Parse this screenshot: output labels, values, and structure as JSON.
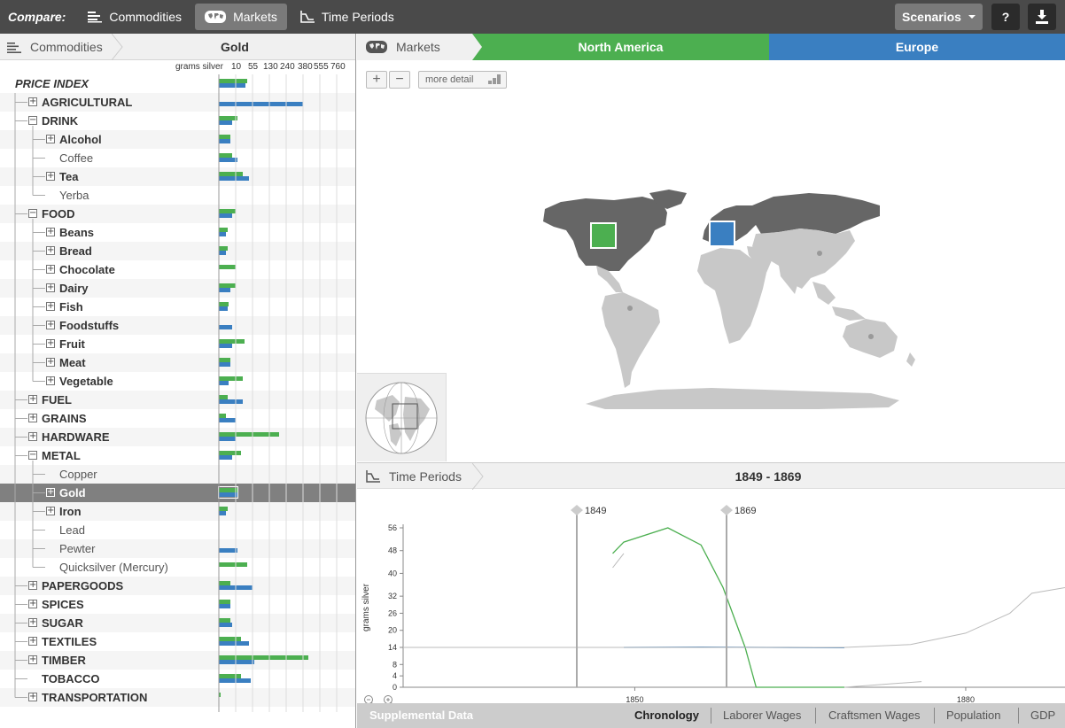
{
  "topbar": {
    "compare_label": "Compare:",
    "commodities_label": "Commodities",
    "markets_label": "Markets",
    "time_periods_label": "Time Periods",
    "scenarios_label": "Scenarios",
    "help_label": "?"
  },
  "left": {
    "crumb_label": "Commodities",
    "selected_commodity": "Gold",
    "scale_unit": "grams silver",
    "scale_ticks": [
      "10",
      "55",
      "130",
      "240",
      "380",
      "555",
      "760"
    ],
    "series_values_note": "",
    "rows": [
      {
        "label": "PRICE INDEX",
        "level": 0,
        "style": "index",
        "expander": "",
        "green": 0.17,
        "blue": 0.16
      },
      {
        "label": "AGRICULTURAL",
        "level": 1,
        "style": "bold",
        "expander": "+",
        "green": 0.0,
        "blue": 0.5
      },
      {
        "label": "DRINK",
        "level": 1,
        "style": "bold",
        "expander": "-",
        "green": 0.11,
        "blue": 0.08
      },
      {
        "label": "Alcohol",
        "level": 2,
        "style": "bold",
        "expander": "+",
        "green": 0.07,
        "blue": 0.07
      },
      {
        "label": "Coffee",
        "level": 2,
        "style": "normal",
        "expander": "",
        "green": 0.08,
        "blue": 0.11
      },
      {
        "label": "Tea",
        "level": 2,
        "style": "bold",
        "expander": "+",
        "green": 0.14,
        "blue": 0.18
      },
      {
        "label": "Yerba",
        "level": 2,
        "style": "normal",
        "expander": "",
        "green": 0,
        "blue": 0
      },
      {
        "label": "FOOD",
        "level": 1,
        "style": "bold",
        "expander": "-",
        "green": 0.1,
        "blue": 0.08
      },
      {
        "label": "Beans",
        "level": 2,
        "style": "bold",
        "expander": "+",
        "green": 0.05,
        "blue": 0.04
      },
      {
        "label": "Bread",
        "level": 2,
        "style": "bold",
        "expander": "+",
        "green": 0.05,
        "blue": 0.04
      },
      {
        "label": "Chocolate",
        "level": 2,
        "style": "bold",
        "expander": "+",
        "green": 0.1,
        "blue": 0
      },
      {
        "label": "Dairy",
        "level": 2,
        "style": "bold",
        "expander": "+",
        "green": 0.1,
        "blue": 0.07
      },
      {
        "label": "Fish",
        "level": 2,
        "style": "bold",
        "expander": "+",
        "green": 0.06,
        "blue": 0.05
      },
      {
        "label": "Foodstuffs",
        "level": 2,
        "style": "bold",
        "expander": "+",
        "green": 0,
        "blue": 0.08
      },
      {
        "label": "Fruit",
        "level": 2,
        "style": "bold",
        "expander": "+",
        "green": 0.15,
        "blue": 0.08
      },
      {
        "label": "Meat",
        "level": 2,
        "style": "bold",
        "expander": "+",
        "green": 0.07,
        "blue": 0.07
      },
      {
        "label": "Vegetable",
        "level": 2,
        "style": "bold",
        "expander": "+",
        "green": 0.14,
        "blue": 0.06
      },
      {
        "label": "FUEL",
        "level": 1,
        "style": "bold",
        "expander": "+",
        "green": 0.05,
        "blue": 0.14
      },
      {
        "label": "GRAINS",
        "level": 1,
        "style": "bold",
        "expander": "+",
        "green": 0.04,
        "blue": 0.1
      },
      {
        "label": "HARDWARE",
        "level": 1,
        "style": "bold",
        "expander": "+",
        "green": 0.36,
        "blue": 0.1
      },
      {
        "label": "METAL",
        "level": 1,
        "style": "bold",
        "expander": "-",
        "green": 0.13,
        "blue": 0.08
      },
      {
        "label": "Copper",
        "level": 2,
        "style": "normal",
        "expander": "",
        "green": 0,
        "blue": 0
      },
      {
        "label": "Gold",
        "level": 2,
        "style": "bold",
        "expander": "+",
        "green": 0.11,
        "blue": 0.11,
        "selected": true
      },
      {
        "label": "Iron",
        "level": 2,
        "style": "bold",
        "expander": "+",
        "green": 0.05,
        "blue": 0.04
      },
      {
        "label": "Lead",
        "level": 2,
        "style": "normal",
        "expander": "",
        "green": 0,
        "blue": 0
      },
      {
        "label": "Pewter",
        "level": 2,
        "style": "normal",
        "expander": "",
        "green": 0,
        "blue": 0.11
      },
      {
        "label": "Quicksilver (Mercury)",
        "level": 2,
        "style": "normal",
        "expander": "",
        "green": 0.17,
        "blue": 0
      },
      {
        "label": "PAPERGOODS",
        "level": 1,
        "style": "bold",
        "expander": "+",
        "green": 0.07,
        "blue": 0.2
      },
      {
        "label": "SPICES",
        "level": 1,
        "style": "bold",
        "expander": "+",
        "green": 0.07,
        "blue": 0.07
      },
      {
        "label": "SUGAR",
        "level": 1,
        "style": "bold",
        "expander": "+",
        "green": 0.07,
        "blue": 0.08
      },
      {
        "label": "TEXTILES",
        "level": 1,
        "style": "bold",
        "expander": "+",
        "green": 0.13,
        "blue": 0.18
      },
      {
        "label": "TIMBER",
        "level": 1,
        "style": "bold",
        "expander": "+",
        "green": 0.53,
        "blue": 0.21
      },
      {
        "label": "TOBACCO",
        "level": 1,
        "style": "bold",
        "expander": "",
        "green": 0.13,
        "blue": 0.19
      },
      {
        "label": "TRANSPORTATION",
        "level": 1,
        "style": "bold",
        "expander": "+",
        "green": 0.01,
        "blue": 0
      }
    ]
  },
  "markets": {
    "crumb_label": "Markets",
    "tabs": [
      {
        "label": "North America",
        "color": "#4caf50"
      },
      {
        "label": "Europe",
        "color": "#3a7fc1"
      }
    ],
    "zoom_in": "+",
    "zoom_out": "−",
    "more_detail": "more detail"
  },
  "time": {
    "crumb_label": "Time Periods",
    "range_label": "1849 - 1869",
    "start_marker": "1849",
    "end_marker": "1869",
    "zoom_out_icon": "zoom-out-icon",
    "zoom_in_icon": "zoom-in-icon"
  },
  "chart_data": {
    "type": "line",
    "ylabel": "grams silver",
    "xlabel": "",
    "y_ticks": [
      0,
      4,
      8,
      14,
      20,
      26,
      32,
      40,
      48,
      56
    ],
    "x_ticks": [
      1850,
      1880
    ],
    "xlim": [
      1829,
      1889
    ],
    "series": [
      {
        "color": "#3a7fc1",
        "x": [
          1849,
          1856,
          1862,
          1869
        ],
        "y": [
          14,
          14.1,
          14,
          13.9
        ]
      },
      {
        "color": "#4caf50",
        "x": [
          1848,
          1849,
          1853,
          1856,
          1858,
          1860,
          1861,
          1864,
          1869
        ],
        "y": [
          47,
          51,
          56,
          50,
          35,
          14,
          0,
          0,
          0
        ]
      },
      {
        "color": "#bbbbbb",
        "x": [
          1829,
          1849,
          1869,
          1875,
          1880,
          1884,
          1886,
          1889
        ],
        "y": [
          14,
          14,
          14,
          15,
          19,
          26,
          33,
          35
        ]
      },
      {
        "color": "#bbbbbb",
        "x": [
          1848,
          1849
        ],
        "y": [
          42,
          47
        ]
      },
      {
        "color": "#bbbbbb",
        "x": [
          1869,
          1876
        ],
        "y": [
          0,
          2
        ]
      }
    ]
  },
  "bottom": {
    "supplemental_label": "Supplemental Data",
    "tabs": [
      "Chronology",
      "Laborer Wages",
      "Craftsmen Wages",
      "Population",
      "GDP"
    ]
  }
}
